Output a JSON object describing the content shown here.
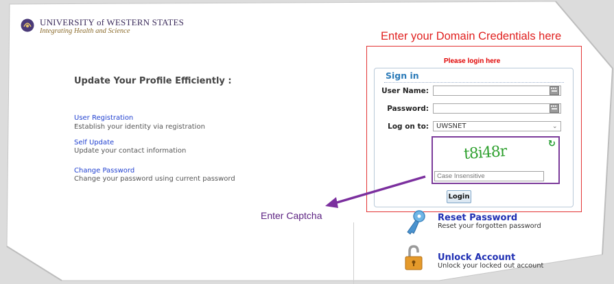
{
  "header": {
    "university_name": "UNIVERSITY of WESTERN STATES",
    "tagline": "Integrating Health and Science"
  },
  "left": {
    "title": "Update Your Profile Efficiently :",
    "links": [
      {
        "label": "User Registration",
        "description": "Establish your identity via registration"
      },
      {
        "label": "Self Update",
        "description": "Update your contact information"
      },
      {
        "label": "Change Password",
        "description": "Change your password using current password"
      }
    ]
  },
  "annotations": {
    "top": "Enter your Domain Credentials here",
    "captcha": "Enter Captcha"
  },
  "login": {
    "message": "Please login here",
    "title": "Sign in",
    "username_label": "User Name:",
    "username_value": "",
    "password_label": "Password:",
    "password_value": "",
    "logon_label": "Log on to:",
    "logon_value": "UWSNET",
    "captcha_image_text": "t8i48r",
    "captcha_placeholder": "Case Insensitive",
    "login_button": "Login"
  },
  "bottom": {
    "reset_title": "Reset Password",
    "reset_desc": "Reset your forgotten password",
    "unlock_title": "Unlock Account",
    "unlock_desc": "Unlock your locked out account"
  },
  "colors": {
    "annotation_red": "#e0201f",
    "annotation_purple": "#5a1f80",
    "link_blue": "#2040d0",
    "captcha_green": "#2fa02f"
  }
}
